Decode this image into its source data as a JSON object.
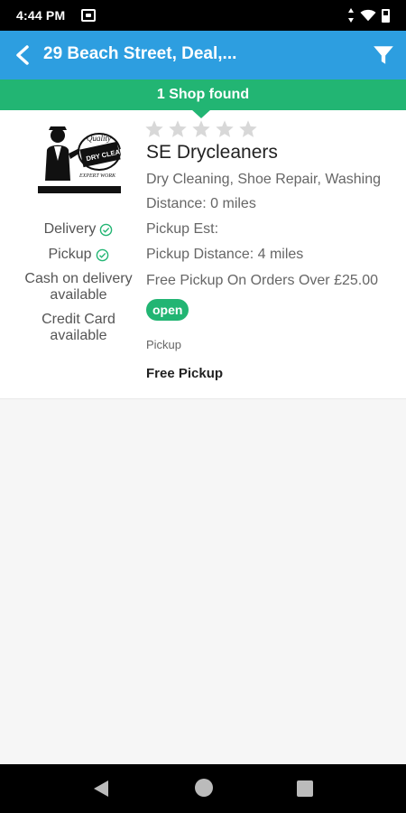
{
  "status_bar": {
    "time": "4:44 PM"
  },
  "app_bar": {
    "title": "29 Beach Street, Deal,..."
  },
  "results": {
    "count_text": "1 Shop found"
  },
  "shop": {
    "name": "SE Drycleaners",
    "rating": 0,
    "rating_max": 5,
    "services": "Dry Cleaning, Shoe Repair, Washing",
    "distance": "Distance: 0 miles",
    "pickup_est": "Pickup Est:",
    "pickup_distance": "Pickup Distance: 4 miles",
    "free_pickup_note": "Free Pickup On Orders Over £25.00",
    "status": "open",
    "pickup_label": "Pickup",
    "pickup_value": "Free Pickup",
    "logo": {
      "icon": "dry-cleaner-logo",
      "text_top": "Quality",
      "text_mid": "DRY CLEANING",
      "text_bottom": "EXPERT WORK"
    },
    "options": {
      "delivery": "Delivery",
      "pickup": "Pickup",
      "cash": "Cash on delivery available",
      "credit": "Credit Card available"
    }
  },
  "colors": {
    "primary": "#2d9ee0",
    "accent": "#22b573",
    "star_empty": "#d8d8d8"
  }
}
